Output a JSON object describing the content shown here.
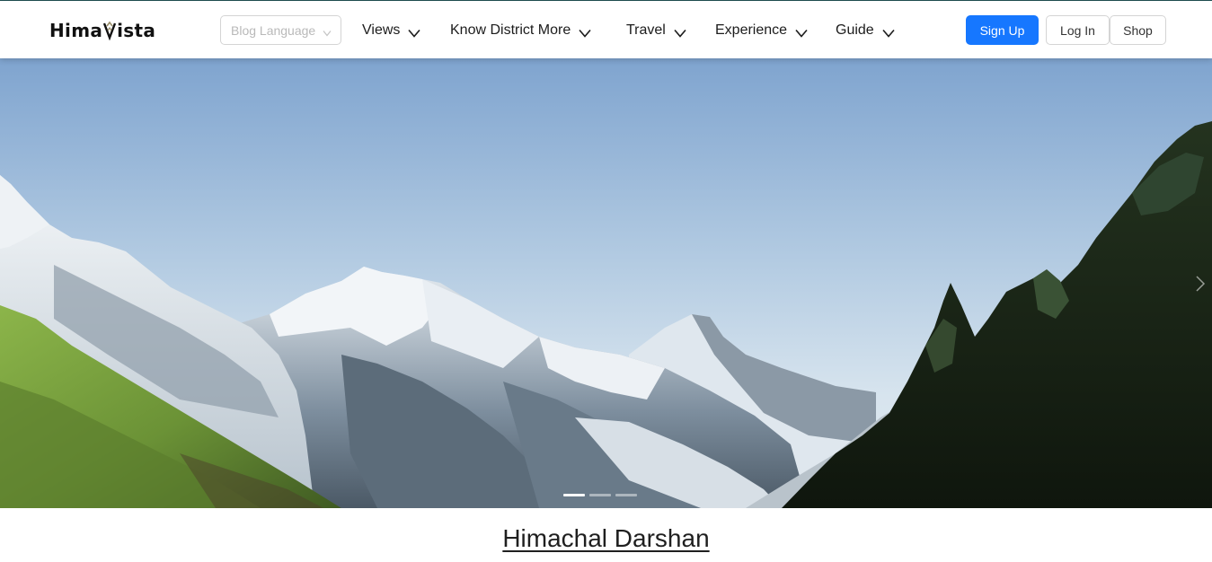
{
  "header": {
    "logo": {
      "text_left": "Hima",
      "text_right": "ista",
      "mark_icon": "mountain-v-icon"
    },
    "blog_language": {
      "placeholder": "Blog Language",
      "icon": "chevron-down-icon"
    },
    "nav": [
      {
        "label": "Views",
        "icon": "chevron-down-icon"
      },
      {
        "label": "Know District More",
        "icon": "chevron-down-icon"
      },
      {
        "label": "Travel",
        "icon": "chevron-down-icon"
      },
      {
        "label": "Experience",
        "icon": "chevron-down-icon"
      },
      {
        "label": "Guide",
        "icon": "chevron-down-icon"
      }
    ],
    "buttons": {
      "signup": "Sign Up",
      "login": "Log In",
      "shop": "Shop"
    }
  },
  "hero": {
    "image_icon": "mountain-landscape-image",
    "next_icon": "chevron-right-icon",
    "slides_visible": 3,
    "active_slide": 1
  },
  "section": {
    "title": "Himachal Darshan"
  },
  "colors": {
    "primary": "#1677ff",
    "top_border": "#1f4f52",
    "text": "#1c1c1c",
    "muted": "#b9b9b9"
  }
}
